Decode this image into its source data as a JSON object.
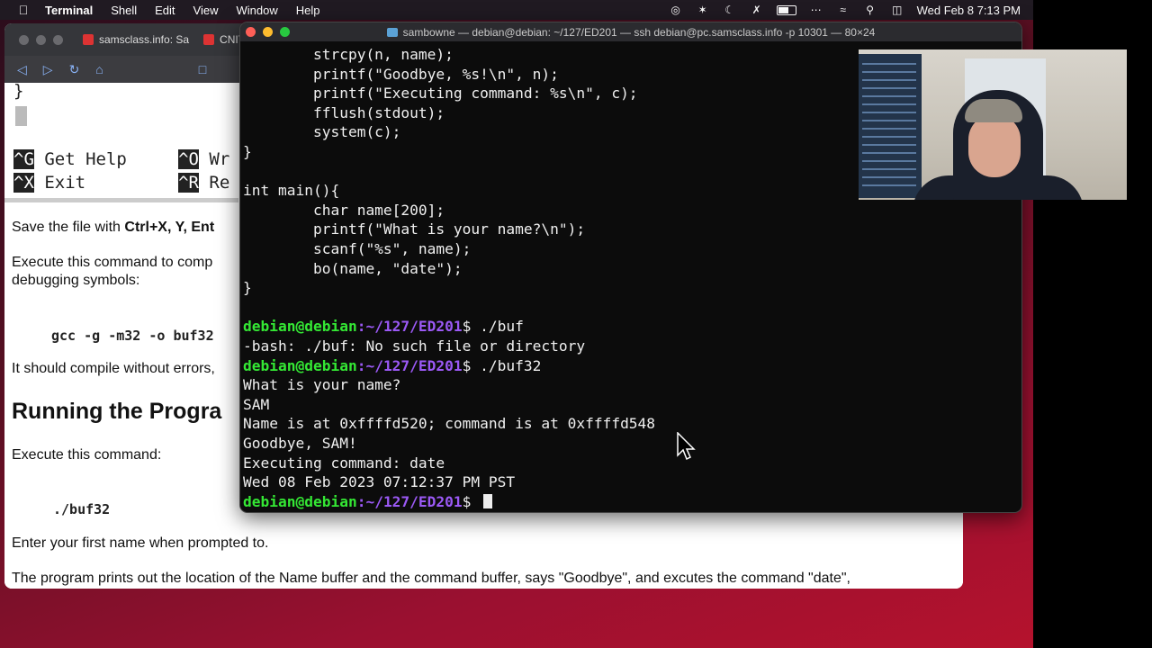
{
  "menubar": {
    "app": "Terminal",
    "menus": [
      "Shell",
      "Edit",
      "View",
      "Window",
      "Help"
    ],
    "clock": "Wed Feb 8  7:13 PM"
  },
  "browser": {
    "tabs": [
      {
        "label": "samsclass.info: Sa"
      },
      {
        "label": "CNIT"
      }
    ]
  },
  "page": {
    "nano_brace": "}",
    "nano_shortcuts": [
      {
        "key": "^G",
        "label": "Get Help",
        "key2": "^O",
        "label2": "Wr"
      },
      {
        "key": "^X",
        "label": "Exit",
        "key2": "^R",
        "label2": "Re"
      }
    ],
    "save_prefix": "Save the file with ",
    "save_keys": "Ctrl+X, Y, Ent",
    "execute_compile_1": "Execute this command to comp",
    "execute_compile_2": "debugging symbols:",
    "gcc_command": "gcc -g -m32 -o buf32",
    "compile_note": "It should compile without errors,",
    "heading": "Running the Progra",
    "execute_this": "Execute this command:",
    "run_command": "./buf32",
    "enter_name": "Enter your first name when prompted to.",
    "prints_out": "The program prints out the location of the Name buffer and the command buffer, says \"Goodbye\", and excutes the command \"date\","
  },
  "terminal": {
    "title": "sambowne — debian@debian: ~/127/ED201 — ssh debian@pc.samsclass.info -p 10301 — 80×24",
    "code_lines": [
      "        strcpy(n, name);",
      "        printf(\"Goodbye, %s!\\n\", n);",
      "        printf(\"Executing command: %s\\n\", c);",
      "        fflush(stdout);",
      "        system(c);",
      "}",
      "",
      "int main(){",
      "        char name[200];",
      "        printf(\"What is your name?\\n\");",
      "        scanf(\"%s\", name);",
      "        bo(name, \"date\");",
      "}",
      ""
    ],
    "prompt_user": "debian@debian",
    "prompt_path": ":~/127/ED201",
    "prompt_symbol": "$",
    "session": [
      {
        "type": "prompt",
        "cmd": " ./buf"
      },
      {
        "type": "out",
        "text": "-bash: ./buf: No such file or directory"
      },
      {
        "type": "prompt",
        "cmd": " ./buf32"
      },
      {
        "type": "out",
        "text": "What is your name?"
      },
      {
        "type": "out",
        "text": "SAM"
      },
      {
        "type": "out",
        "text": "Name is at 0xffffd520; command is at 0xffffd548"
      },
      {
        "type": "out",
        "text": "Goodbye, SAM!"
      },
      {
        "type": "out",
        "text": "Executing command: date"
      },
      {
        "type": "out",
        "text": "Wed 08 Feb 2023 07:12:37 PM PST"
      },
      {
        "type": "prompt",
        "cmd": " ",
        "cursor": true
      }
    ]
  },
  "icons": {
    "apple": "apple-icon",
    "wifi": "wifi-icon",
    "search": "search-icon",
    "battery": "battery-icon"
  }
}
